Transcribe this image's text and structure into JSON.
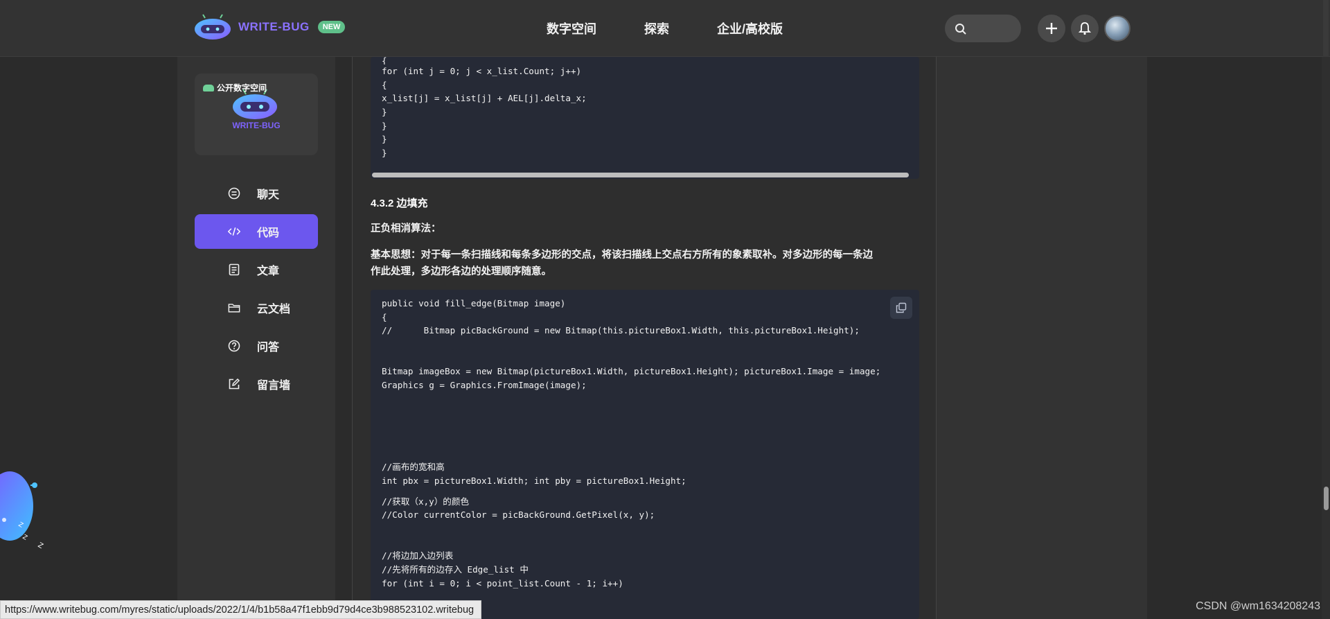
{
  "brand": {
    "name": "WRITE-BUG",
    "badge": "NEW",
    "accent": "#6c57ee"
  },
  "nav": {
    "items": [
      "数字空间",
      "探索",
      "企业/高校版"
    ]
  },
  "header_icons": [
    "search-icon",
    "plus-icon",
    "bell-icon",
    "avatar"
  ],
  "sidebar": {
    "space_label": "公开数字空间",
    "space_name": "WRITE-BUG",
    "items": [
      {
        "label": "聊天",
        "icon": "chat-icon",
        "active": false
      },
      {
        "label": "代码",
        "icon": "code-icon",
        "active": true
      },
      {
        "label": "文章",
        "icon": "article-icon",
        "active": false
      },
      {
        "label": "云文档",
        "icon": "folder-icon",
        "active": false
      },
      {
        "label": "问答",
        "icon": "question-icon",
        "active": false
      },
      {
        "label": "留言墙",
        "icon": "edit-icon",
        "active": false
      }
    ]
  },
  "content": {
    "code1": [
      "{",
      "for (int j = 0; j < x_list.Count; j++)",
      "{",
      "x_list[j] = x_list[j] + AEL[j].delta_x;",
      "}",
      "}",
      "}",
      "}"
    ],
    "heading": "4.3.2 边填充",
    "subheading": "正负相消算法：",
    "paragraph_line1": "基本思想：对于每一条扫描线和每条多边形的交点，将该扫描线上交点右方所有的象素取补。对多边形的每一条边",
    "paragraph_line2": "作此处理，多边形各边的处理顺序随意。",
    "code2": [
      "public void fill_edge(Bitmap image)",
      "{",
      "//      Bitmap picBackGround = new Bitmap(this.pictureBox1.Width, this.pictureBox1.Height);",
      "",
      "",
      "Bitmap imageBox = new Bitmap(pictureBox1.Width, pictureBox1.Height); pictureBox1.Image = image;",
      "Graphics g = Graphics.FromImage(image);",
      "",
      "",
      "",
      "",
      "",
      "//画布的宽和高",
      "int pbx = pictureBox1.Width; int pby = pictureBox1.Height;",
      "",
      "//获取（x,y）的颜色",
      "//Color currentColor = picBackGround.GetPixel(x, y);",
      "",
      "",
      "//将边加入边列表",
      "//先将所有的边存入 Edge_list 中",
      "for (int i = 0; i < point_list.Count - 1; i++)"
    ],
    "copy_icon": "copy-icon"
  },
  "status_url": "https://www.writebug.com/myres/static/uploads/2022/1/4/b1b58a47f1ebb9d79d4ce3b988523102.writebug",
  "watermark": "CSDN @wm1634208243"
}
